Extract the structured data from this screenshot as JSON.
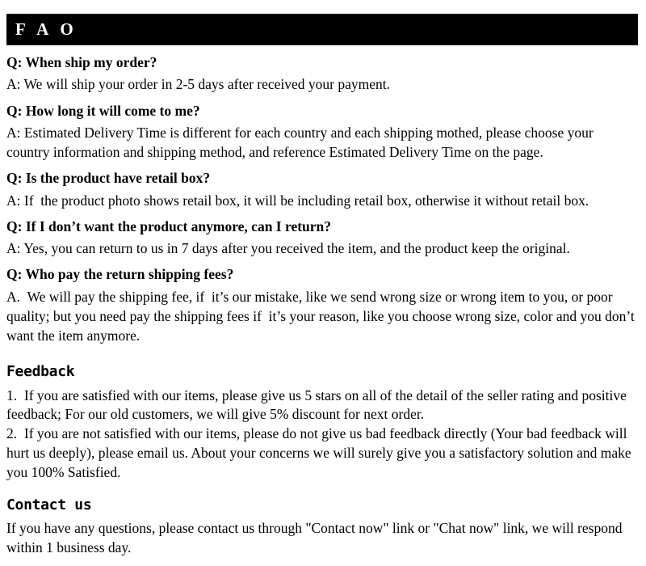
{
  "header": {
    "title": "F A O"
  },
  "faq": {
    "items": [
      {
        "question": "Q: When ship my order?",
        "answer": "A: We will ship your order in 2-5 days after received your payment."
      },
      {
        "question": "Q: How long it will come to me?",
        "answer": "A: Estimated Delivery Time is different for each country and each shipping mothed, please choose your country information and shipping method, and reference Estimated Delivery Time on the page."
      },
      {
        "question": "Q: Is the product have retail box?",
        "answer": "A: If  the product photo shows retail box, it will be including retail box, otherwise it without retail box."
      },
      {
        "question": "Q: If I don’t want the product anymore, can I return?",
        "answer": "A: Yes, you can return to us in 7 days after you received the item, and the product keep the original."
      },
      {
        "question": "Q: Who pay the return shipping fees?",
        "answer": "A.  We will pay the shipping fee, if  it’s our mistake, like we send wrong size or wrong item to you, or poor quality; but you need pay the shipping fees if  it’s your reason, like you choose wrong size, color and you don’t want the item anymore."
      }
    ]
  },
  "feedback": {
    "heading": "Feedback",
    "body": "1.  If you are satisfied with our items, please give us 5 stars on all of the detail of the seller rating and positive feedback; For our old customers, we will give 5% discount for next order.\n2.  If you are not satisfied with our items, please do not give us bad feedback directly (Your bad feedback will hurt us deeply), please email us. About your concerns we will surely give you a satisfactory solution and make you 100% Satisfied."
  },
  "contact": {
    "heading": "Contact us",
    "body": "If you have any questions, please contact us through \"Contact now\" link or \"Chat now\" link, we will respond within 1 business day."
  },
  "colors": {
    "header_background": "#000000",
    "header_text": "#ffffff",
    "page_background": "#ffffff",
    "body_text": "#000000"
  }
}
